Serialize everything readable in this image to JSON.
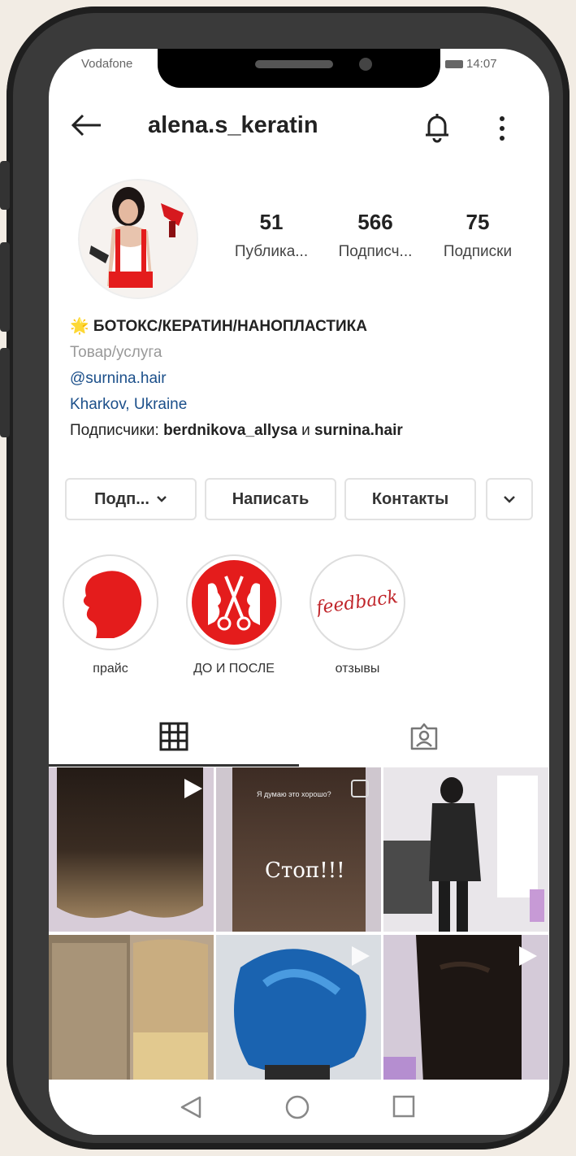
{
  "status": {
    "carrier": "Vodafone",
    "time": "14:07"
  },
  "profile": {
    "username": "alena.s_keratin",
    "stats": [
      {
        "value": "51",
        "label": "Публика..."
      },
      {
        "value": "566",
        "label": "Подписч..."
      },
      {
        "value": "75",
        "label": "Подписки"
      }
    ],
    "bio_name": "🌟 БОТОКС/КЕРАТИН/НАНОПЛАСТИКА",
    "category": "Товар/услуга",
    "link": "@surnina.hair",
    "location": "Kharkov, Ukraine",
    "followers_prefix": "Подписчики: ",
    "followers_user1": "berdnikova_allysa",
    "followers_and": " и ",
    "followers_user2": "surnina.hair"
  },
  "actions": {
    "follow": "Подп...",
    "message": "Написать",
    "contacts": "Контакты"
  },
  "highlights": [
    {
      "label": "прайс"
    },
    {
      "label": "ДО И ПОСЛЕ"
    },
    {
      "label": "отзывы",
      "cover_text": "feedback"
    }
  ],
  "posts": {
    "overlay_text": "Стоп!!!",
    "small_caption": "Я думаю это хорошо?"
  },
  "colors": {
    "accent_red": "#e41c1c",
    "link_blue": "#1b4f8a"
  },
  "icons": [
    "back-arrow-icon",
    "bell-icon",
    "more-vert-icon",
    "grid-icon",
    "tagged-icon",
    "video-icon",
    "multi-post-icon",
    "nav-back-icon",
    "nav-home-icon",
    "nav-recents-icon"
  ]
}
